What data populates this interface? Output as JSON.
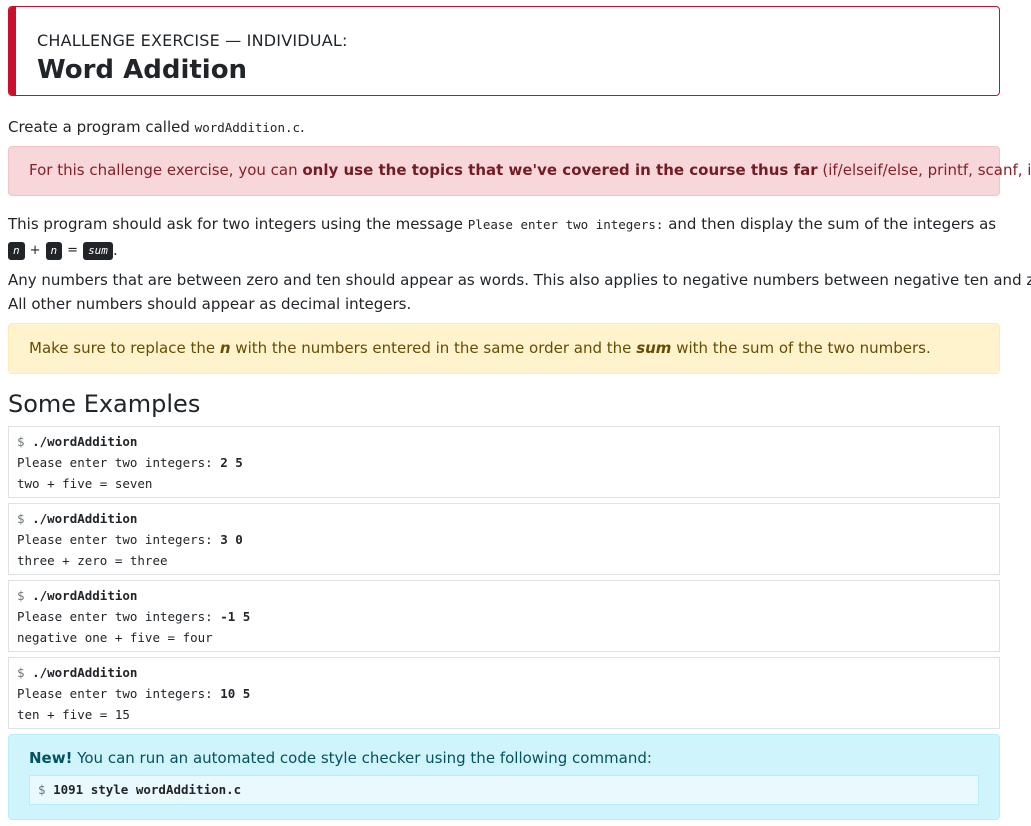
{
  "header": {
    "kicker": "CHALLENGE EXERCISE — INDIVIDUAL:",
    "title": "Word Addition"
  },
  "intro": {
    "prefix": "Create a program called ",
    "filename": "wordAddition.c",
    "suffix": "."
  },
  "danger_alert": {
    "prefix": "For this challenge exercise, you can ",
    "bold": "only use the topics that we've covered in the course thus far",
    "suffix": " (if/elseif/else, printf, scanf, ints)."
  },
  "description": {
    "part1": "This program should ask for two integers using the message ",
    "message": "Please enter two integers:",
    "part2": " and then display the sum of the integers as",
    "kbd_n1": "n",
    "plus": "+",
    "kbd_n2": "n",
    "equals": "=",
    "kbd_sum": "sum",
    "period": "."
  },
  "rules": {
    "line1": "Any numbers that are between zero and ten should appear as words. This also applies to negative numbers between negative ten and zero.",
    "line2": "All other numbers should appear as decimal integers."
  },
  "warning_alert": {
    "prefix": "Make sure to replace the ",
    "n": "n",
    "middle": " with the numbers entered in the same order and the ",
    "sum": "sum",
    "suffix": " with the sum of the two numbers."
  },
  "examples_heading": "Some Examples",
  "examples": [
    {
      "prompt": "$ ",
      "command": "./wordAddition",
      "ask": "Please enter two integers: ",
      "input": "2 5",
      "output": "two + five = seven"
    },
    {
      "prompt": "$ ",
      "command": "./wordAddition",
      "ask": "Please enter two integers: ",
      "input": "3 0",
      "output": "three + zero = three"
    },
    {
      "prompt": "$ ",
      "command": "./wordAddition",
      "ask": "Please enter two integers: ",
      "input": "-1 5",
      "output": "negative one + five = four"
    },
    {
      "prompt": "$ ",
      "command": "./wordAddition",
      "ask": "Please enter two integers: ",
      "input": "10 5",
      "output": "ten + five = 15"
    }
  ],
  "info_alert": {
    "new_label": "New!",
    "text": " You can run an automated code style checker using the following command:",
    "prompt": "$ ",
    "command": "1091 style wordAddition.c"
  }
}
